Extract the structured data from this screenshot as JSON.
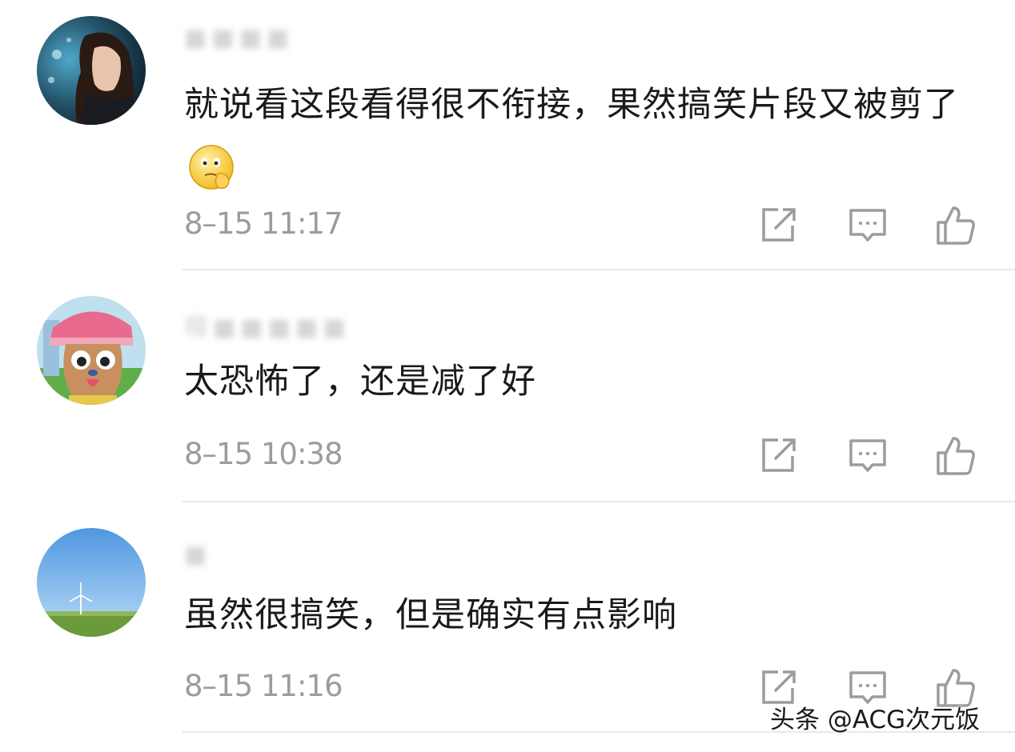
{
  "comments": [
    {
      "text": "就说看这段看得很不衔接，果然搞笑片段又被剪了",
      "has_emoji": true,
      "time": "8–15 11:17"
    },
    {
      "text": "太恐怖了，还是减了好",
      "time": "8–15 10:38"
    },
    {
      "text": "虽然很搞笑，但是确实有点影响",
      "time": "8–15 11:16"
    }
  ],
  "icons": {
    "share": "share-icon",
    "reply": "comment-icon",
    "like": "thumbs-up-icon",
    "color": "#9c9c9c"
  },
  "watermark": "头条 @ACG次元饭"
}
